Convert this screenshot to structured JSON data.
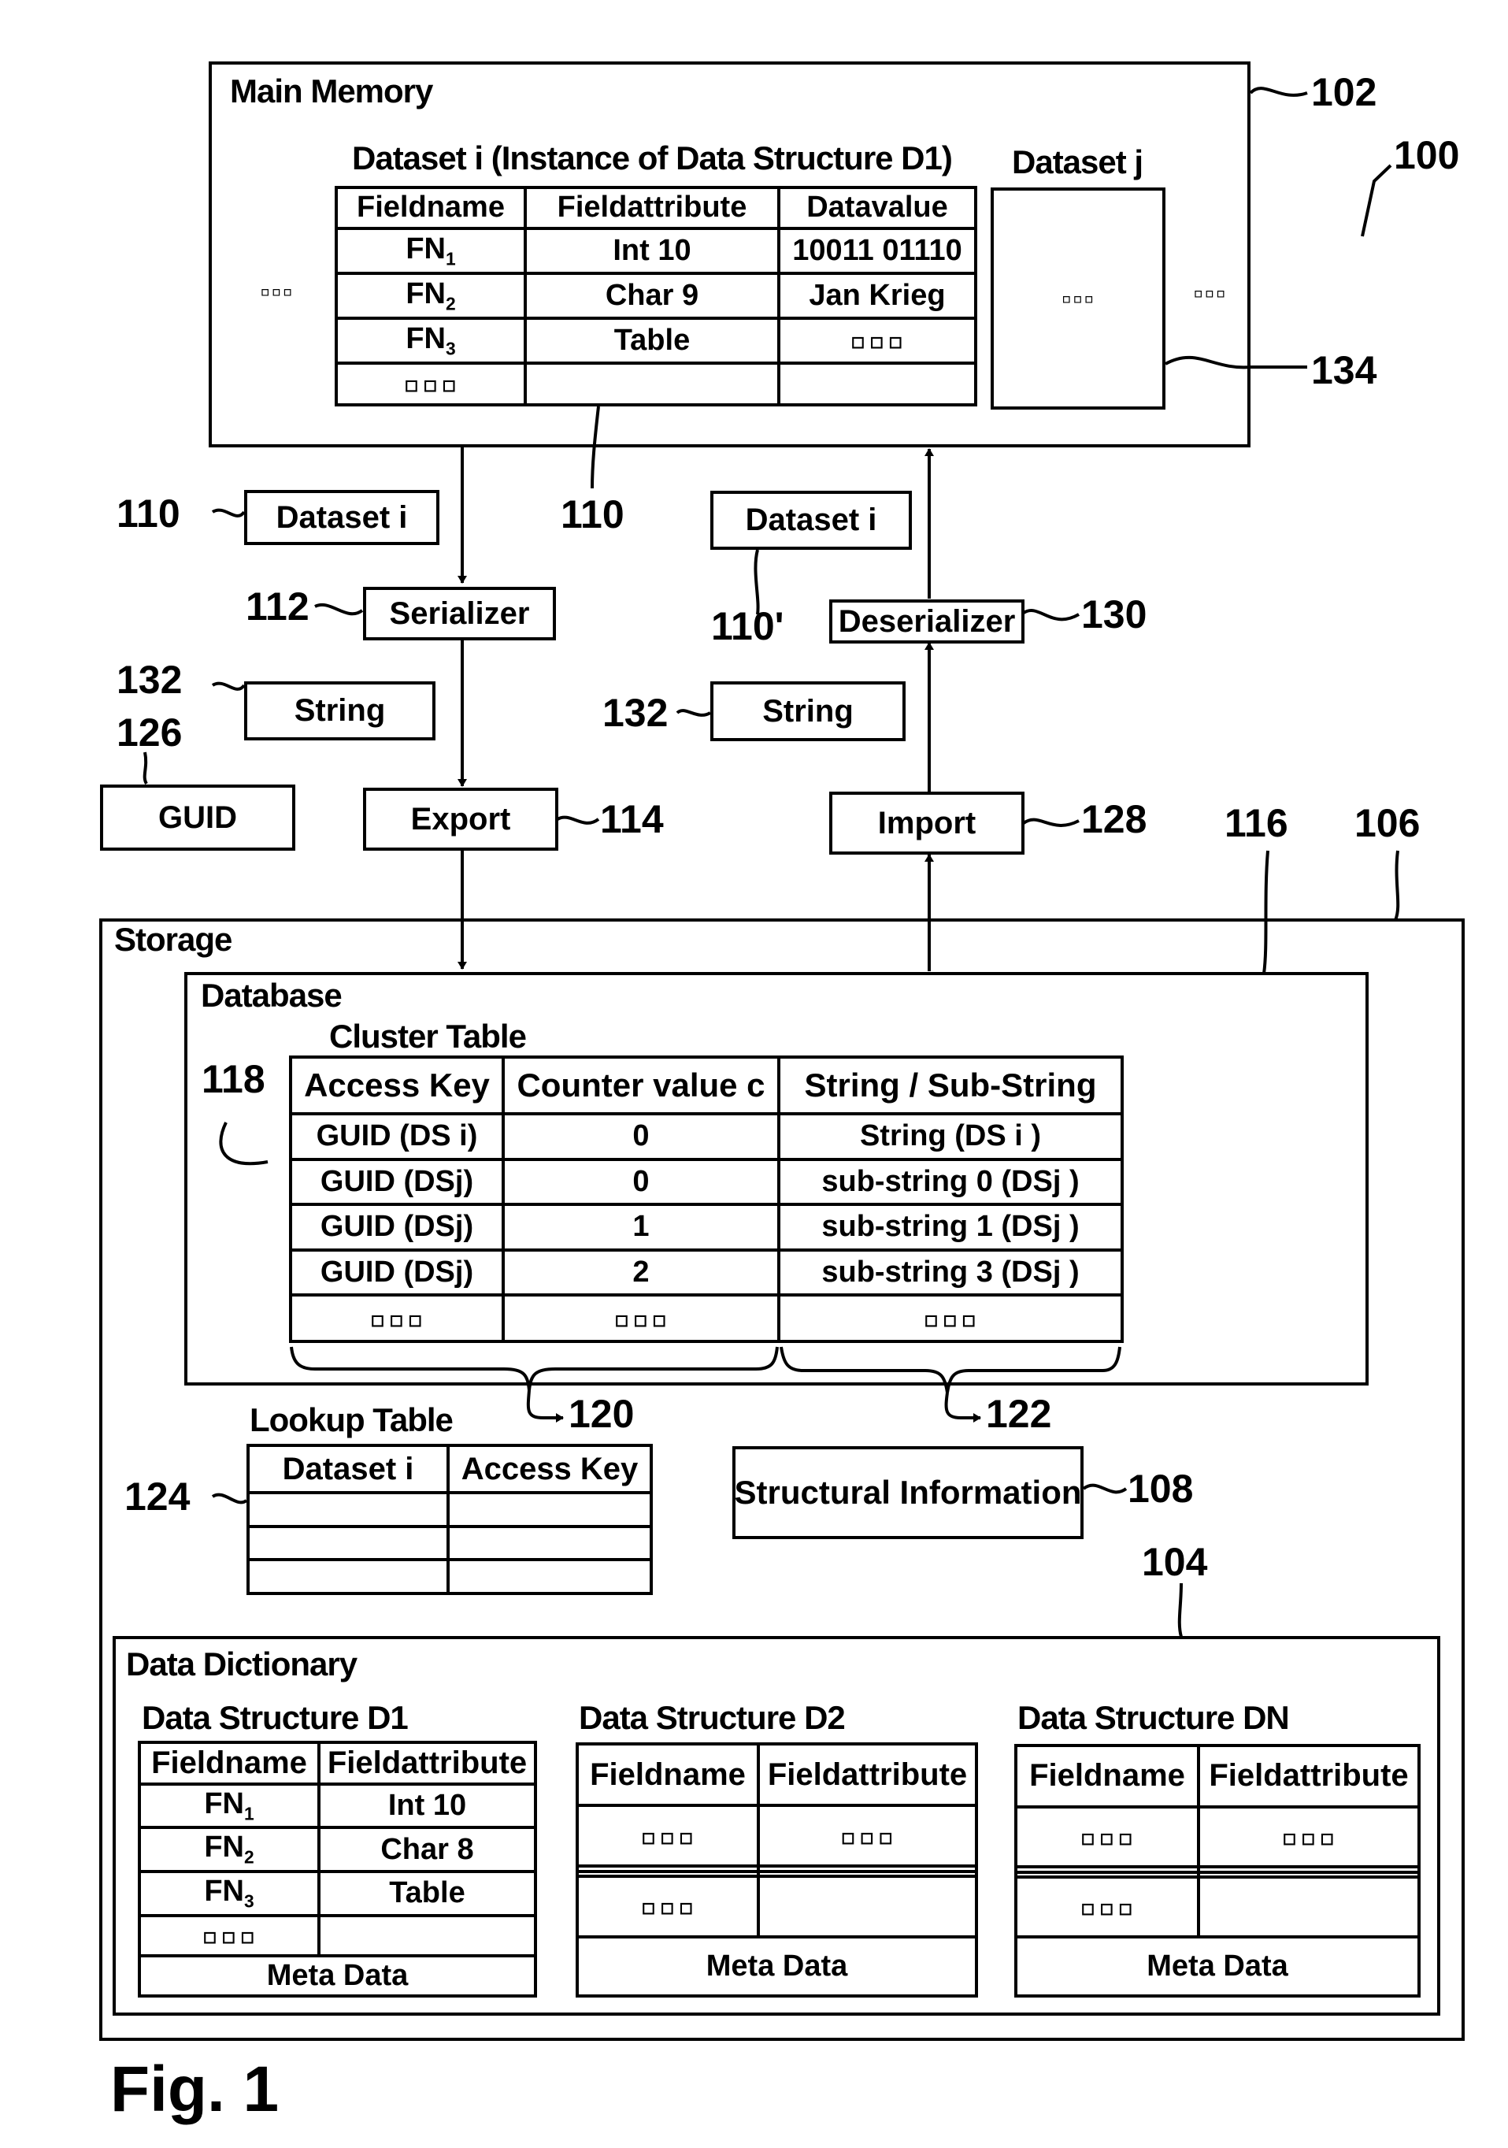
{
  "figure_label": "Fig. 1",
  "ellipsis": "▫▫▫",
  "refs": {
    "r100": "100",
    "r102": "102",
    "r104": "104",
    "r106": "106",
    "r108": "108",
    "r110_left": "110",
    "r110_mid": "110",
    "r110p": "110'",
    "r112": "112",
    "r114": "114",
    "r116": "116",
    "r118": "118",
    "r120": "120",
    "r122": "122",
    "r124": "124",
    "r126": "126",
    "r128": "128",
    "r130": "130",
    "r132_left": "132",
    "r132_right": "132",
    "r134": "134"
  },
  "main_memory": {
    "title": "Main Memory",
    "dataset_i": {
      "title": "Dataset i (Instance of Data Structure D1)",
      "headers": [
        "Fieldname",
        "Fieldattribute",
        "Datavalue"
      ],
      "rows": [
        {
          "name": "FN",
          "sub": "1",
          "attr": "Int 10",
          "value": "10011 01110"
        },
        {
          "name": "FN",
          "sub": "2",
          "attr": "Char 9",
          "value": "Jan Krieg"
        },
        {
          "name": "FN",
          "sub": "3",
          "attr": "Table",
          "value": "▫▫▫"
        },
        {
          "name": "▫▫▫",
          "sub": "",
          "attr": "",
          "value": ""
        }
      ]
    },
    "dataset_j": {
      "title": "Dataset j",
      "content": "▫▫▫"
    }
  },
  "export_path": {
    "dataset_box": "Dataset i",
    "serializer": "Serializer",
    "string_box": "String",
    "guid_box": "GUID",
    "export": "Export"
  },
  "import_path": {
    "dataset_box": "Dataset i",
    "deserializer": "Deserializer",
    "string_box": "String",
    "import": "Import"
  },
  "storage": {
    "title": "Storage",
    "database": {
      "title": "Database",
      "cluster_table": {
        "title": "Cluster Table",
        "headers": [
          "Access Key",
          "Counter value c",
          "String / Sub-String"
        ],
        "rows": [
          [
            "GUID (DS i)",
            "0",
            "String (DS i )"
          ],
          [
            "GUID (DSj)",
            "0",
            "sub-string 0 (DSj )"
          ],
          [
            "GUID (DSj)",
            "1",
            "sub-string 1 (DSj )"
          ],
          [
            "GUID (DSj)",
            "2",
            "sub-string 3 (DSj )"
          ],
          [
            "▫▫▫",
            "▫▫▫",
            "▫▫▫"
          ]
        ]
      }
    },
    "lookup_table": {
      "title": "Lookup Table",
      "headers": [
        "Dataset i",
        "Access Key"
      ],
      "rows": [
        [
          "",
          ""
        ],
        [
          "",
          ""
        ],
        [
          "",
          ""
        ]
      ]
    },
    "structural_information": "Structural Information",
    "data_dictionary": {
      "title": "Data Dictionary",
      "structures": [
        {
          "title": "Data Structure D1",
          "headers": [
            "Fieldname",
            "Fieldattribute"
          ],
          "rows": [
            {
              "name": "FN",
              "sub": "1",
              "attr": "Int 10"
            },
            {
              "name": "FN",
              "sub": "2",
              "attr": "Char 8"
            },
            {
              "name": "FN",
              "sub": "3",
              "attr": "Table"
            },
            {
              "name": "▫▫▫",
              "sub": "",
              "attr": ""
            }
          ],
          "footer": "Meta Data"
        },
        {
          "title": "Data Structure D2",
          "headers": [
            "Fieldname",
            "Fieldattribute"
          ],
          "rows": [
            {
              "name": "▫▫▫",
              "sub": "",
              "attr": "▫▫▫"
            },
            {
              "name": "",
              "sub": "",
              "attr": ""
            },
            {
              "name": "",
              "sub": "",
              "attr": ""
            },
            {
              "name": "▫▫▫",
              "sub": "",
              "attr": ""
            }
          ],
          "footer": "Meta Data"
        },
        {
          "title": "Data Structure DN",
          "headers": [
            "Fieldname",
            "Fieldattribute"
          ],
          "rows": [
            {
              "name": "▫▫▫",
              "sub": "",
              "attr": "▫▫▫"
            },
            {
              "name": "",
              "sub": "",
              "attr": ""
            },
            {
              "name": "",
              "sub": "",
              "attr": ""
            },
            {
              "name": "▫▫▫",
              "sub": "",
              "attr": ""
            }
          ],
          "footer": "Meta Data"
        }
      ]
    }
  }
}
